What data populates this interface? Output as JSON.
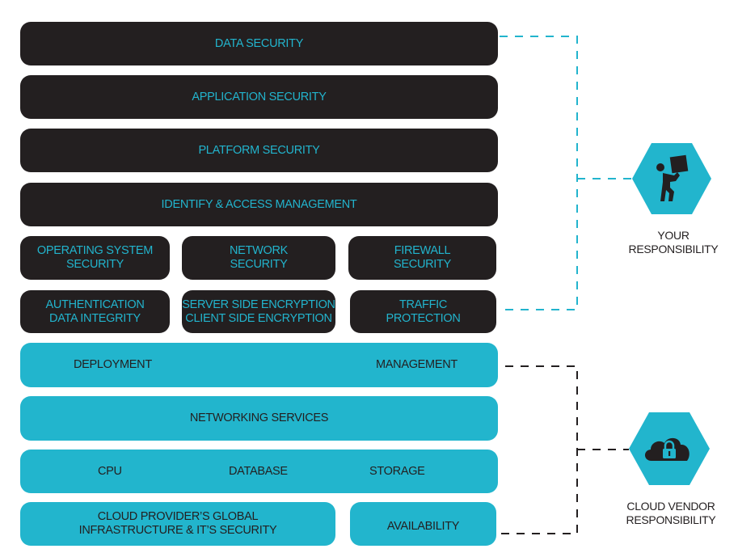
{
  "colors": {
    "dark_block": "#231f20",
    "teal_block": "#22b5cd",
    "dark_text": "#22b4cd",
    "teal_text": "#231f20",
    "customer_connector": "#22b4cd",
    "vendor_connector": "#231f20"
  },
  "customer_layers": {
    "data_security": "DATA SECURITY",
    "application_security": "APPLICATION SECURITY",
    "platform_security": "PLATFORM SECURITY",
    "iam": "IDENTIFY & ACCESS MANAGEMENT",
    "row5": [
      {
        "line1": "OPERATING SYSTEM",
        "line2": "SECURITY"
      },
      {
        "line1": "NETWORK",
        "line2": "SECURITY"
      },
      {
        "line1": "FIREWALL",
        "line2": "SECURITY"
      }
    ],
    "row6": [
      {
        "line1": "AUTHENTICATION",
        "line2": "DATA INTEGRITY"
      },
      {
        "line1": "SERVER SIDE ENCRYPTION",
        "line2": "CLIENT SIDE ENCRYPTION"
      },
      {
        "line1": "TRAFFIC",
        "line2": "PROTECTION"
      }
    ]
  },
  "vendor_layers": {
    "row1": {
      "left": "DEPLOYMENT",
      "right": "MANAGEMENT"
    },
    "row2": "NETWORKING SERVICES",
    "row3": {
      "left": "CPU",
      "center": "DATABASE",
      "right": "STORAGE"
    },
    "row4": {
      "infrastructure": {
        "line1": "CLOUD PROVIDER’S GLOBAL",
        "line2": "INFRASTRUCTURE & IT’S SECURITY"
      },
      "availability": "AVAILABILITY"
    }
  },
  "legend": {
    "customer": {
      "icon": "person-carrying-box-icon",
      "line1": "YOUR",
      "line2": "RESPONSIBILITY"
    },
    "vendor": {
      "icon": "cloud-lock-icon",
      "line1": "CLOUD VENDOR",
      "line2": "RESPONSIBILITY"
    }
  }
}
